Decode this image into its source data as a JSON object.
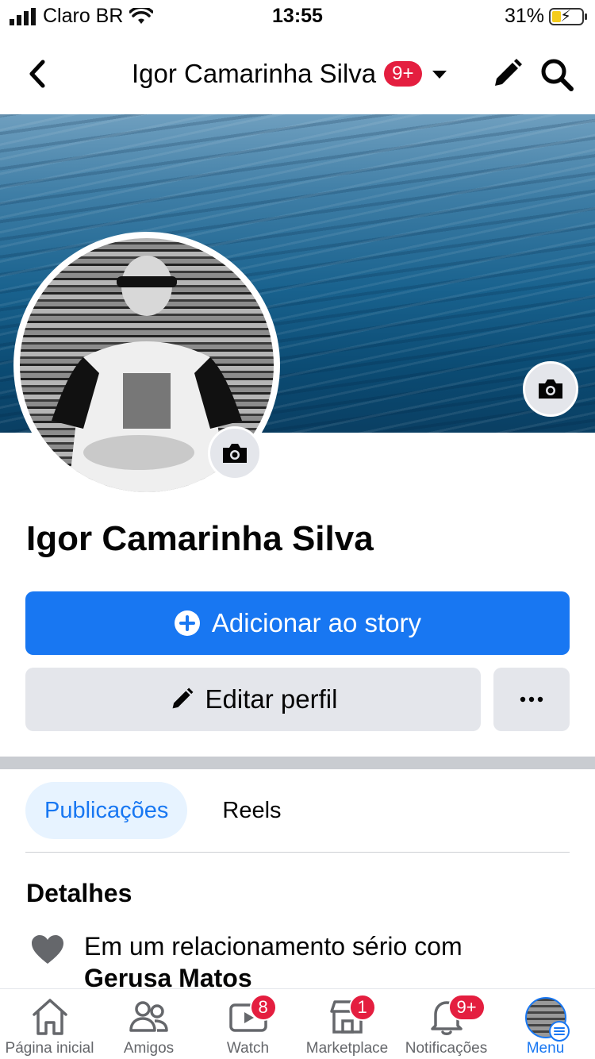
{
  "status_bar": {
    "carrier": "Claro BR",
    "time": "13:55",
    "battery": "31%",
    "battery_level": 0.31
  },
  "top_nav": {
    "title": "Igor Camarinha Silva",
    "notification_badge": "9+",
    "icons": [
      "back-icon",
      "chevron-down-icon",
      "pencil-icon",
      "search-icon"
    ]
  },
  "profile": {
    "name": "Igor Camarinha Silva"
  },
  "actions": {
    "story_label": "Adicionar ao story",
    "edit_label": "Editar perfil",
    "more_label": "•••"
  },
  "tabs": [
    {
      "label": "Publicações",
      "active": true
    },
    {
      "label": "Reels",
      "active": false
    }
  ],
  "details": {
    "title": "Detalhes",
    "relationship_prefix": "Em um relacionamento sério com",
    "relationship_partner": "Gerusa Matos"
  },
  "bottom_nav": [
    {
      "label": "Página inicial",
      "icon": "home-icon",
      "badge": ""
    },
    {
      "label": "Amigos",
      "icon": "friends-icon",
      "badge": ""
    },
    {
      "label": "Watch",
      "icon": "watch-icon",
      "badge": "8"
    },
    {
      "label": "Marketplace",
      "icon": "marketplace-icon",
      "badge": "1"
    },
    {
      "label": "Notificações",
      "icon": "bell-icon",
      "badge": "9+"
    },
    {
      "label": "Menu",
      "icon": "menu-icon",
      "badge": "",
      "active": true
    }
  ],
  "colors": {
    "accent": "#1877f2",
    "badge": "#e41e3f",
    "button_gray": "#e4e6eb"
  }
}
